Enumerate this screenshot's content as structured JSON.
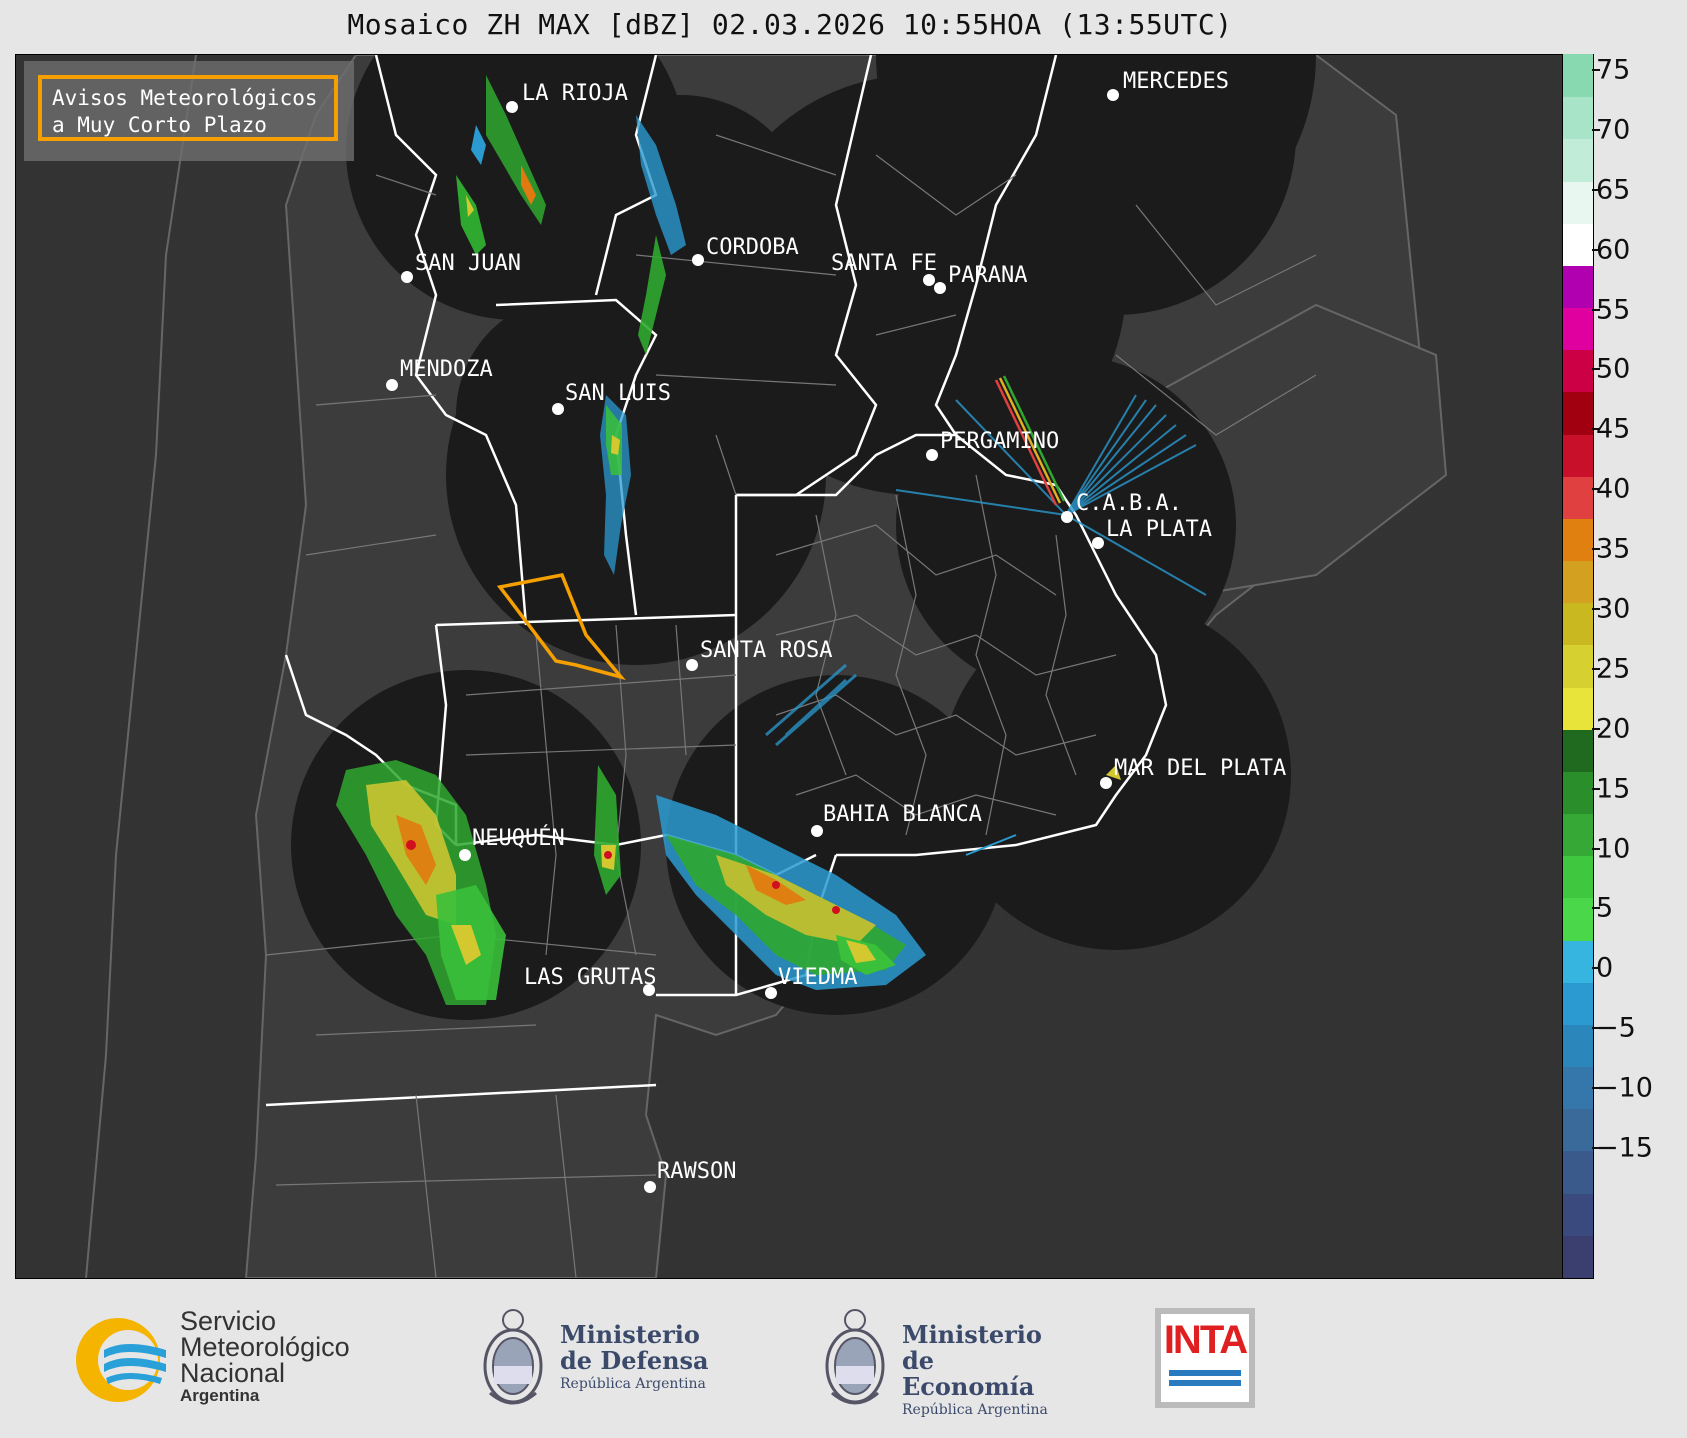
{
  "title": "Mosaico ZH MAX [dBZ] 02.03.2026 10:55HOA (13:55UTC)",
  "warning_box": {
    "line1": "Avisos Meteorológicos",
    "line2": "a Muy Corto Plazo"
  },
  "cities": [
    {
      "name": "LA RIOJA"
    },
    {
      "name": "MERCEDES"
    },
    {
      "name": "CORDOBA"
    },
    {
      "name": "SAN JUAN"
    },
    {
      "name": "SANTA FE"
    },
    {
      "name": "PARANA"
    },
    {
      "name": "MENDOZA"
    },
    {
      "name": "SAN LUIS"
    },
    {
      "name": "PERGAMINO"
    },
    {
      "name": "C.A.B.A."
    },
    {
      "name": "LA PLATA"
    },
    {
      "name": "SANTA ROSA"
    },
    {
      "name": "MAR DEL PLATA"
    },
    {
      "name": "BAHIA BLANCA"
    },
    {
      "name": "NEUQUÉN"
    },
    {
      "name": "LAS GRUTAS"
    },
    {
      "name": "VIEDMA"
    },
    {
      "name": "RAWSON"
    }
  ],
  "colorbar": {
    "unit": "dBZ",
    "ticks": [
      "75",
      "70",
      "65",
      "60",
      "55",
      "50",
      "45",
      "40",
      "35",
      "30",
      "25",
      "20",
      "15",
      "10",
      "5",
      "0",
      "−5",
      "−10",
      "−15"
    ],
    "colors": [
      "#3a3f70",
      "#3b4a7e",
      "#3a5a8c",
      "#3a6a9a",
      "#3577aa",
      "#2a86bb",
      "#2a9ad0",
      "#35b5e0",
      "#4ad84a",
      "#3fc83f",
      "#35a835",
      "#2a8f2a",
      "#206a20",
      "#e8e43a",
      "#d6d030",
      "#c9b820",
      "#d4a020",
      "#e08010",
      "#e04040",
      "#c8102a",
      "#a00010",
      "#cc0044",
      "#e000a0",
      "#b000b0",
      "#ffffff",
      "#e8f8f0",
      "#c0ecd8",
      "#a8e4c8",
      "#88d8b0"
    ]
  },
  "footer": {
    "smn_line1": "Servicio",
    "smn_line2": "Meteorológico",
    "smn_line3": "Nacional",
    "smn_line4": "Argentina",
    "defensa_line1": "Ministerio",
    "defensa_line2": "de Defensa",
    "defensa_line3": "República Argentina",
    "economia_line1": "Ministerio",
    "economia_line2": "de Economía",
    "economia_line3": "República Argentina",
    "inta": "INTA"
  }
}
